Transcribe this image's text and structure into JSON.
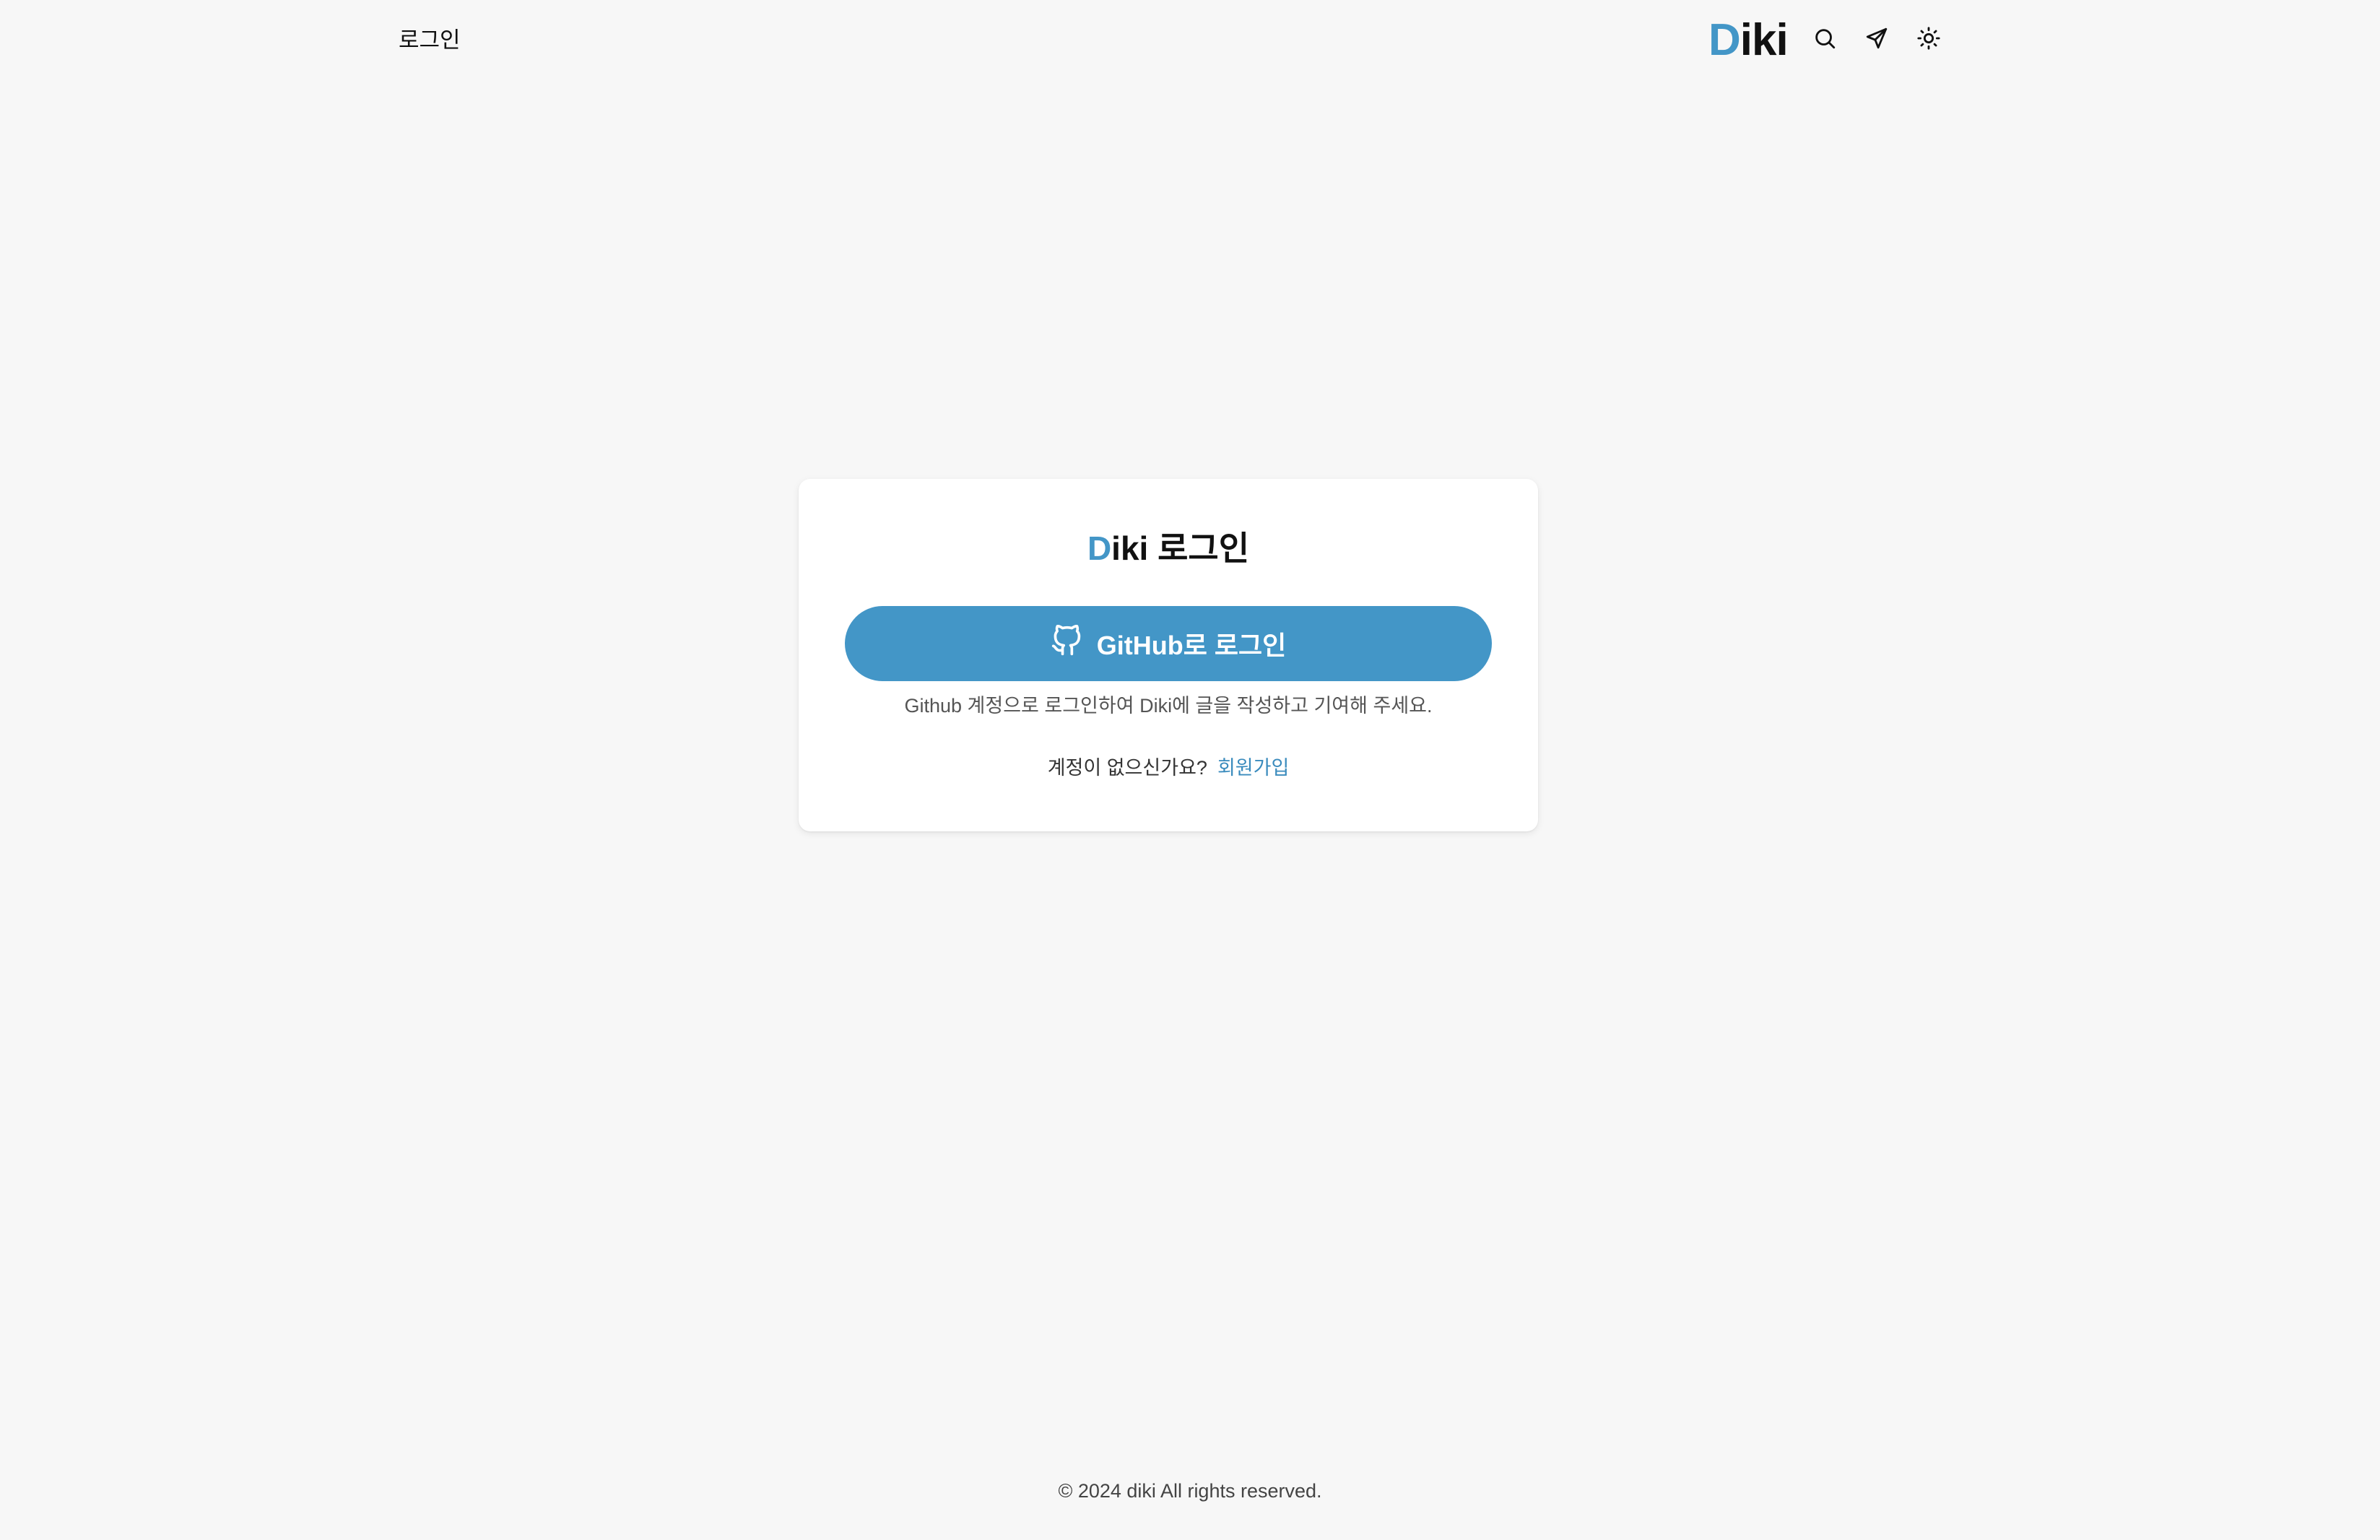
{
  "header": {
    "page_title": "로그인",
    "logo_accent": "D",
    "logo_rest": "iki",
    "icons": [
      "search-icon",
      "send-icon",
      "sun-icon"
    ]
  },
  "login_card": {
    "title_accent": "D",
    "title_rest": "iki 로그인",
    "github_button_label": "GitHub로 로그인",
    "helper_text": "Github 계정으로 로그인하여 Diki에 글을 작성하고 기여해 주세요.",
    "signup_prompt": "계정이 없으신가요?",
    "signup_link": "회원가입"
  },
  "footer": {
    "copyright": "© 2024 diki All rights reserved."
  },
  "colors": {
    "accent": "#4396c7",
    "background": "#f7f7f7",
    "card": "#ffffff",
    "text": "#111111"
  }
}
